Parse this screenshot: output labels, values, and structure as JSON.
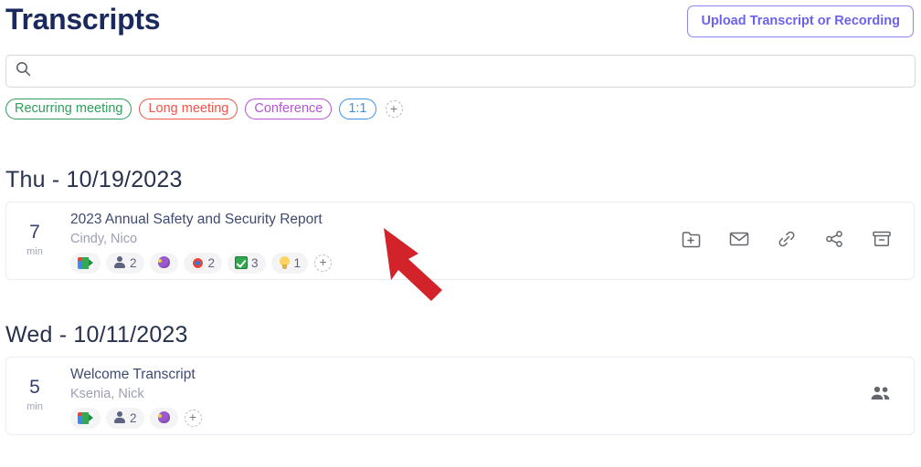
{
  "header": {
    "title": "Transcripts",
    "upload_button_label": "Upload Transcript or Recording"
  },
  "search": {
    "value": "",
    "placeholder": "",
    "icon": "search-icon"
  },
  "filter_tags": [
    {
      "label": "Recurring meeting",
      "color": "#2e9e5b"
    },
    {
      "label": "Long meeting",
      "color": "#f0554b"
    },
    {
      "label": "Conference",
      "color": "#b655d6"
    },
    {
      "label": "1:1",
      "color": "#3b93e8"
    }
  ],
  "filter_tags_add_label": "+",
  "groups": [
    {
      "date_label": "Thu - 10/19/2023",
      "cards": [
        {
          "duration": "7",
          "duration_unit": "min",
          "title": "2023 Annual Safety and Security Report",
          "participants": "Cindy, Nico",
          "badges": [
            {
              "icon": "google-meet-icon",
              "count": ""
            },
            {
              "icon": "person-icon",
              "count": "2"
            },
            {
              "icon": "brain-icon",
              "count": ""
            },
            {
              "icon": "target-icon",
              "count": "2"
            },
            {
              "icon": "checkbox-icon",
              "count": "3"
            },
            {
              "icon": "lightbulb-icon",
              "count": "1"
            }
          ],
          "actions": [
            "add-to-folder-icon",
            "email-icon",
            "link-icon",
            "share-icon",
            "archive-icon"
          ]
        }
      ]
    },
    {
      "date_label": "Wed - 10/11/2023",
      "cards": [
        {
          "duration": "5",
          "duration_unit": "min",
          "title": "Welcome Transcript",
          "participants": "Ksenia, Nick",
          "badges": [
            {
              "icon": "google-meet-icon",
              "count": ""
            },
            {
              "icon": "person-icon",
              "count": "2"
            },
            {
              "icon": "brain-icon",
              "count": ""
            }
          ],
          "actions": [
            "people-icon"
          ]
        }
      ]
    }
  ],
  "annotation": {
    "type": "arrow",
    "color": "#d2222a",
    "points_to": "2023 Annual Safety and Security Report"
  },
  "colors": {
    "title": "#1b2a5e",
    "accent": "#6c63ed",
    "card_border": "#eeeaf6",
    "badge_bg": "#f4f4f6"
  }
}
